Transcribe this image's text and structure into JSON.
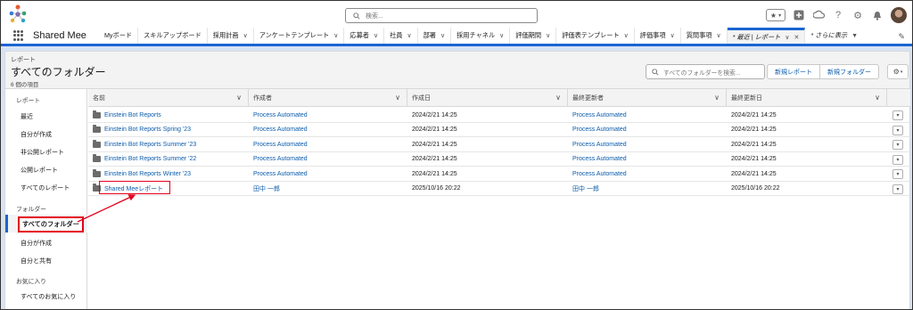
{
  "header": {
    "search_placeholder": "検索...",
    "favorites_icon": "star-icon",
    "icons": [
      "add-icon",
      "cloud-icon",
      "help-icon",
      "gear-icon",
      "bell-icon"
    ]
  },
  "nav": {
    "app_name": "Shared Mee",
    "items": [
      {
        "label": "Myボード",
        "chevron": false
      },
      {
        "label": "スキルアップボード",
        "chevron": false
      },
      {
        "label": "採用計画",
        "chevron": true
      },
      {
        "label": "アンケートテンプレート",
        "chevron": true
      },
      {
        "label": "応募者",
        "chevron": true
      },
      {
        "label": "社員",
        "chevron": true
      },
      {
        "label": "部署",
        "chevron": true
      },
      {
        "label": "採用チャネル",
        "chevron": true
      },
      {
        "label": "評価期間",
        "chevron": true
      },
      {
        "label": "評価表テンプレート",
        "chevron": true
      },
      {
        "label": "評価事項",
        "chevron": true
      },
      {
        "label": "質問事項",
        "chevron": true
      }
    ],
    "active_tab": "* 最近 | レポート",
    "more": "* さらに表示"
  },
  "page": {
    "eyebrow": "レポート",
    "title": "すべてのフォルダー",
    "count": "6 個の項目",
    "search_placeholder": "すべてのフォルダーを検索...",
    "new_report": "新規レポート",
    "new_folder": "新規フォルダー"
  },
  "sidebar": {
    "reports_section": "レポート",
    "report_items": [
      "最近",
      "自分が作成",
      "非公開レポート",
      "公開レポート",
      "すべてのレポート"
    ],
    "folders_section": "フォルダー",
    "active_folder": "すべてのフォルダー",
    "folder_items": [
      "自分が作成",
      "自分と共有"
    ],
    "favorites_section": "お気に入り",
    "favorite_items": [
      "すべてのお気に入り"
    ]
  },
  "table": {
    "columns": [
      "名前",
      "作成者",
      "作成日",
      "最終更新者",
      "最終更新日"
    ],
    "rows": [
      {
        "name": "Einstein Bot Reports",
        "created_by": "Process Automated",
        "created": "2024/2/21 14:25",
        "modified_by": "Process Automated",
        "modified": "2024/2/21 14:25"
      },
      {
        "name": "Einstein Bot Reports Spring '23",
        "created_by": "Process Automated",
        "created": "2024/2/21 14:25",
        "modified_by": "Process Automated",
        "modified": "2024/2/21 14:25"
      },
      {
        "name": "Einstein Bot Reports Summer '23",
        "created_by": "Process Automated",
        "created": "2024/2/21 14:25",
        "modified_by": "Process Automated",
        "modified": "2024/2/21 14:25"
      },
      {
        "name": "Einstein Bot Reports Summer '22",
        "created_by": "Process Automated",
        "created": "2024/2/21 14:25",
        "modified_by": "Process Automated",
        "modified": "2024/2/21 14:25"
      },
      {
        "name": "Einstein Bot Reports Winter '23",
        "created_by": "Process Automated",
        "created": "2024/2/21 14:25",
        "modified_by": "Process Automated",
        "modified": "2024/2/21 14:25"
      },
      {
        "name": "Shared Meeレポート",
        "created_by": "田中 一郎",
        "created": "2025/10/16 20:22",
        "modified_by": "田中 一郎",
        "modified": "2025/10/16 20:22"
      }
    ]
  },
  "colors": {
    "accent": "#1b64d2",
    "link": "#0b5cab",
    "highlight": "#e3001b"
  }
}
